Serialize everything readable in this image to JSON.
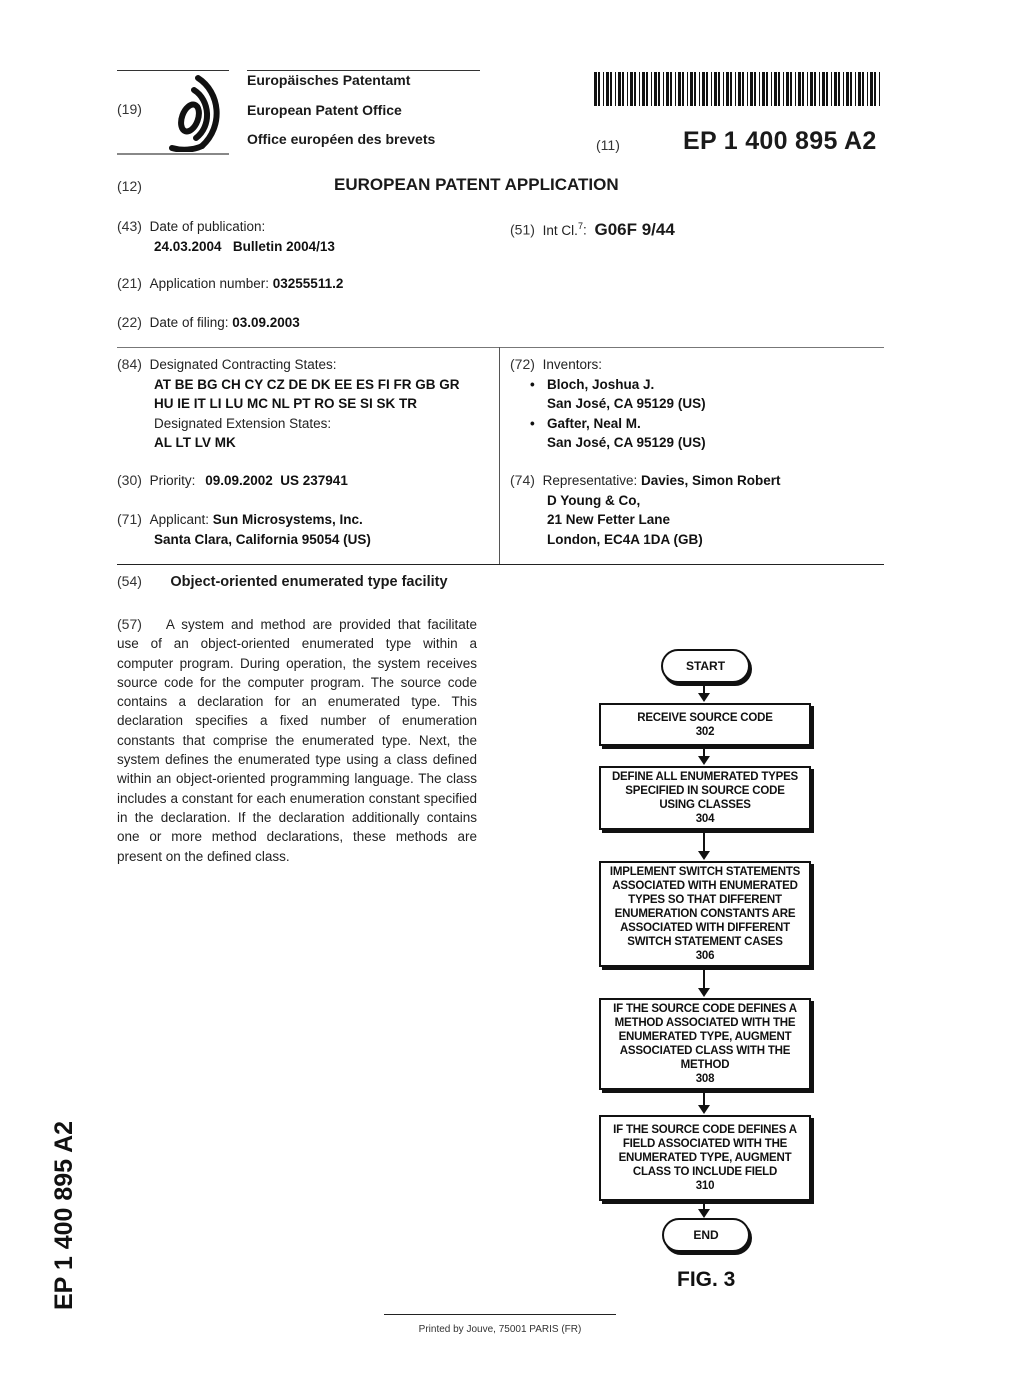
{
  "header": {
    "code_19": "(19)",
    "office_names": [
      "Europäisches Patentamt",
      "European Patent Office",
      "Office européen des brevets"
    ],
    "logo_icon": "epo-logo-icon",
    "code_11": "(11)",
    "publication_number": "EP 1 400 895 A2",
    "code_12": "(12)",
    "document_type": "EUROPEAN PATENT APPLICATION"
  },
  "biblio": {
    "publication_date": {
      "code": "(43)",
      "label": "Date of publication:",
      "value": "24.03.2004   Bulletin 2004/13"
    },
    "int_cl": {
      "code": "(51)",
      "label": "Int Cl.",
      "superscript": "7",
      "colon": ":",
      "value": "G06F 9/44"
    },
    "application_number": {
      "code": "(21)",
      "label": "Application number:",
      "value": "03255511.2"
    },
    "filing_date": {
      "code": "(22)",
      "label": "Date of filing:",
      "value": "03.09.2003"
    },
    "designated_states": {
      "code": "(84)",
      "label": "Designated Contracting States:",
      "lines": [
        "AT BE BG CH CY CZ DE DK EE ES FI FR GB GR",
        "HU IE IT LI LU MC NL PT RO SE SI SK TR"
      ],
      "extension_label": "Designated Extension States:",
      "extension_value": "AL LT LV MK"
    },
    "priority": {
      "code": "(30)",
      "label": "Priority:",
      "value": "09.09.2002  US 237941"
    },
    "applicant": {
      "code": "(71)",
      "label": "Applicant:",
      "name": "Sun Microsystems, Inc.",
      "address": "Santa Clara, California 95054 (US)"
    },
    "inventors": {
      "code": "(72)",
      "label": "Inventors:",
      "list": [
        {
          "name": "Bloch, Joshua J.",
          "address": "San José, CA 95129 (US)"
        },
        {
          "name": "Gafter, Neal M.",
          "address": "San José, CA 95129 (US)"
        }
      ],
      "bullet": "•"
    },
    "representative": {
      "code": "(74)",
      "label": "Representative:",
      "name": "Davies, Simon Robert",
      "lines": [
        "D Young & Co,",
        "21 New Fetter Lane",
        "London, EC4A 1DA (GB)"
      ]
    }
  },
  "title": {
    "code": "(54)",
    "text": "Object-oriented enumerated type facility"
  },
  "abstract": {
    "code": "(57)",
    "text": "A system and method are provided that facilitate use of an object-oriented enumerated type within a computer program. During operation, the system receives source code for the computer program. The source code contains a declaration for an enumerated type. This declaration specifies a fixed number of enumeration constants that comprise the enumerated type. Next, the system defines the enumerated type using a class defined within an object-oriented programming language. The class includes a constant for each enumeration constant specified in the declaration. If the declaration additionally contains one or more method declarations, these methods are present on the defined class."
  },
  "figure": {
    "label": "FIG. 3",
    "start": "START",
    "end": "END",
    "steps": [
      {
        "lines": [
          "RECEIVE SOURCE CODE"
        ],
        "ref": "302"
      },
      {
        "lines": [
          "DEFINE ALL ENUMERATED TYPES",
          "SPECIFIED IN SOURCE CODE",
          "USING CLASSES"
        ],
        "ref": "304"
      },
      {
        "lines": [
          "IMPLEMENT SWITCH STATEMENTS",
          "ASSOCIATED WITH ENUMERATED",
          "TYPES SO THAT DIFFERENT",
          "ENUMERATION CONSTANTS ARE",
          "ASSOCIATED WITH DIFFERENT",
          "SWITCH STATEMENT CASES"
        ],
        "ref": "306"
      },
      {
        "lines": [
          "IF THE SOURCE CODE DEFINES A",
          "METHOD ASSOCIATED WITH THE",
          "ENUMERATED TYPE, AUGMENT",
          "ASSOCIATED CLASS WITH THE",
          "METHOD"
        ],
        "ref": "308"
      },
      {
        "lines": [
          "IF THE SOURCE CODE DEFINES A",
          "FIELD ASSOCIATED WITH THE",
          "ENUMERATED TYPE, AUGMENT",
          "CLASS TO INCLUDE FIELD"
        ],
        "ref": "310"
      }
    ]
  },
  "side_label": "EP 1 400 895 A2",
  "footer": "Printed by Jouve, 75001 PARIS (FR)"
}
